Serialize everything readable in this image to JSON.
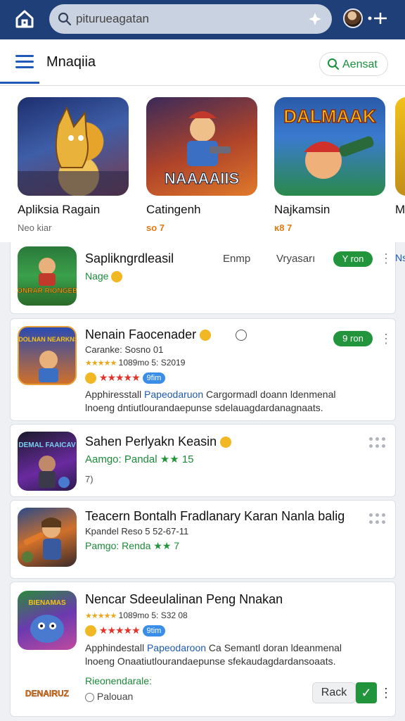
{
  "topbar": {
    "search_value": "piturueagatan",
    "icons": [
      "home-icon",
      "search-icon",
      "sparkle-icon",
      "avatar",
      "add-person-icon"
    ]
  },
  "subheader": {
    "title": "Mnaqiia",
    "search_button_label": "Aensat"
  },
  "carousel": [
    {
      "name": "Apliksia Ragain",
      "sub": "Neo kiar",
      "sub_style": "gray"
    },
    {
      "name": "Catingenh",
      "sub": "so 7",
      "sub_style": "orange"
    },
    {
      "name": "Najkamsin",
      "sub": "ĸ8 7",
      "sub_style": "orange"
    },
    {
      "name": "M",
      "sub": "",
      "sub_style": "orange"
    }
  ],
  "carousel_icon_texts": [
    "",
    "NAAAAIIS",
    "DALMAAK",
    ""
  ],
  "list": [
    {
      "title": "Saplikngrdleasil",
      "col2": "Enmp",
      "col3": "Vryasarı",
      "line1": "Nage",
      "install_label": "Y ron",
      "extra_right": "Ns",
      "icon_text": "DONRAR RIONGEBS"
    },
    {
      "title": "Nenain Faocenader",
      "line1": "Caranke: Sosno 01",
      "line2": "1089mo 5: S2019",
      "line3_pill": "9fim",
      "desc_prefix": "Apphiresstall ",
      "desc_blue": "Papeodaruon",
      "desc_rest": " Cargormadl doann ldenmenal",
      "desc_line2": "lnoeng dntiutlourandaepunse sdelauagdardanagnaats.",
      "install_label": "9 ron",
      "icon_text": "DOLNAN NEARKNS"
    },
    {
      "title": "Sahen Perlyakn Keasin",
      "line1": "Aamgo: Pandal",
      "line1_tail": "15",
      "line2": "7)",
      "icon_text": "DEMAL FAAICAV"
    },
    {
      "title": "Teacern Bontalh Fradlanary Karan Nanla balig",
      "line1": "Kpandel Reso 5 52-67-11",
      "line2": "Pamgo: Renda",
      "line2_tail": "7",
      "icon_text": ""
    },
    {
      "title": "Nencar Sdeeulalinan Peng Nnakan",
      "line1": "1089mo 5: S32 08",
      "line2_pill": "9tim",
      "desc_prefix": "Apphindestall ",
      "desc_blue": "Papeodaroon",
      "desc_rest": " Ca Semantl doran ldeanmenal",
      "desc_line2": "lnoeng Onaatiutlourandaepunse sfekaudagdardansoaats.",
      "footer_green": "Rieonendarale:",
      "footer_note": "Palouan",
      "rack_label": "Rack",
      "icon_text": "BIENAMAS",
      "mini_logo_text": "DENAIRUZ"
    }
  ],
  "colors": {
    "topbar": "#1f3f78",
    "accent_blue": "#1f5bb6",
    "green": "#22953c",
    "orange": "#e07a12"
  }
}
